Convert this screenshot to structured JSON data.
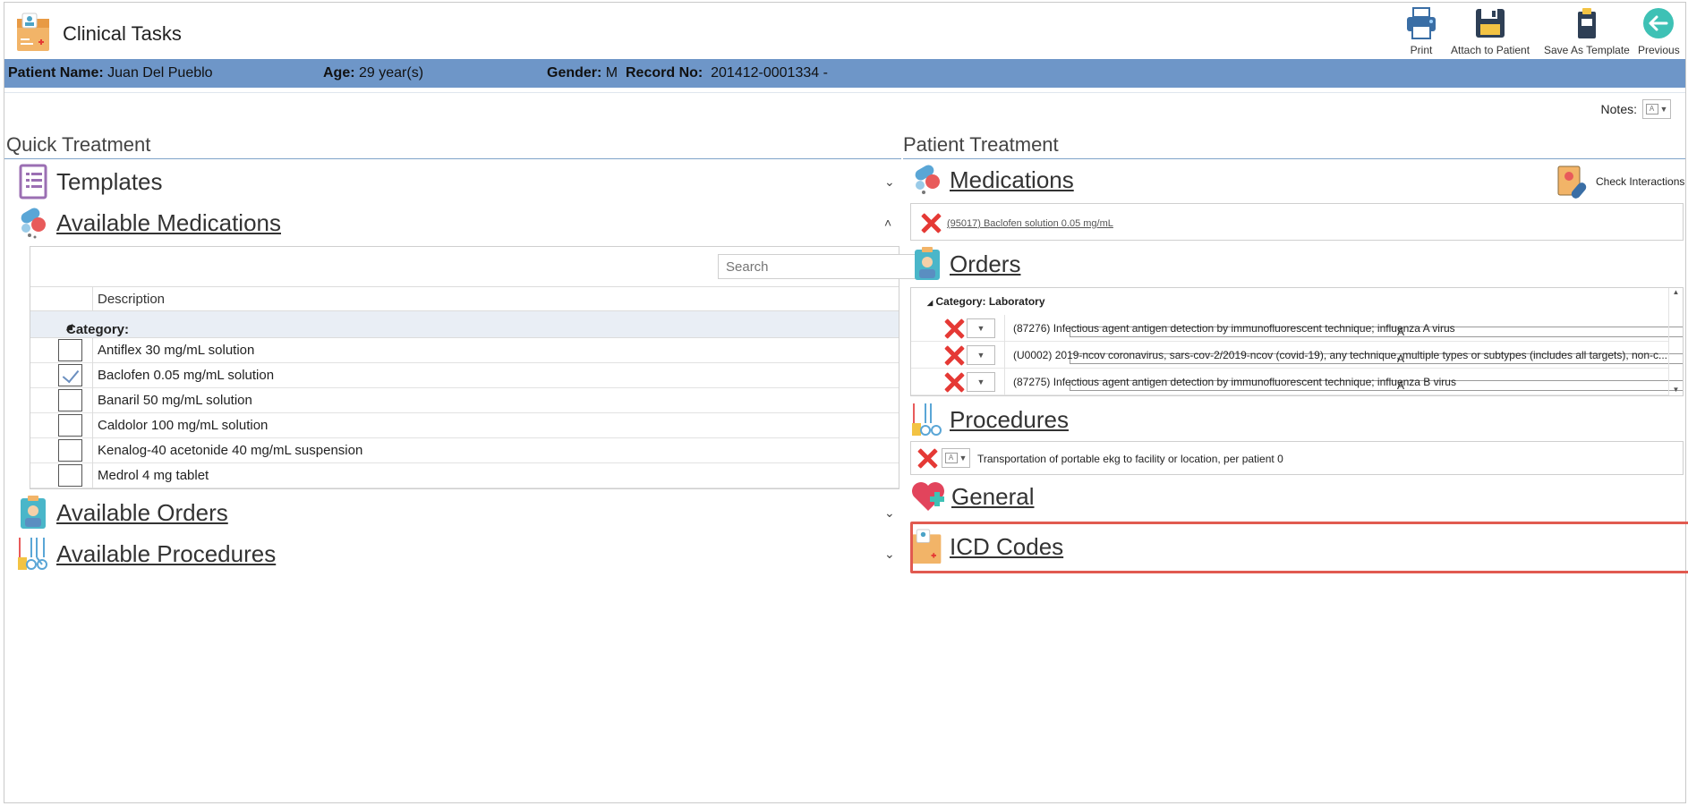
{
  "app": {
    "title": "Clinical Tasks"
  },
  "toolbar": {
    "print": "Print",
    "attach": "Attach to Patient",
    "save_template": "Save As Template",
    "previous": "Previous"
  },
  "patient": {
    "name_label": "Patient Name:",
    "name": "Juan Del Pueblo",
    "age_label": "Age:",
    "age": "29 year(s)",
    "gender_label": "Gender:",
    "gender": "M",
    "record_label": "Record No:",
    "record": "201412-0001334 -"
  },
  "notes": {
    "label": "Notes:"
  },
  "quick_treatment": {
    "title": "Quick Treatment",
    "templates": "Templates",
    "available_medications": "Available Medications",
    "available_orders": "Available Orders",
    "available_procedures": "Available Procedures",
    "search_placeholder": "Search",
    "column_description": "Description",
    "category": "Category:",
    "medications": [
      {
        "name": "Antiflex 30 mg/mL solution",
        "checked": false
      },
      {
        "name": "Baclofen 0.05 mg/mL solution",
        "checked": true
      },
      {
        "name": "Banaril 50 mg/mL solution",
        "checked": false
      },
      {
        "name": "Caldolor 100 mg/mL solution",
        "checked": false
      },
      {
        "name": "Kenalog-40 acetonide 40 mg/mL suspension",
        "checked": false
      },
      {
        "name": "Medrol 4 mg tablet",
        "checked": false
      }
    ]
  },
  "patient_treatment": {
    "title": "Patient Treatment",
    "medications": "Medications",
    "check_interactions": "Check Interactions",
    "med_items": [
      "(95017) Baclofen solution 0.05 mg/mL"
    ],
    "orders": "Orders",
    "orders_category": "Category: Laboratory",
    "order_items": [
      "(87276) Infectious agent antigen detection by immunofluorescent technique; influenza A virus",
      "(U0002) 2019-ncov coronavirus, sars-cov-2/2019-ncov (covid-19), any technique, multiple types or subtypes (includes all targets), non-c...",
      "(87275) Infectious agent antigen detection by immunofluorescent technique; influenza B virus"
    ],
    "procedures": "Procedures",
    "procedure_items": [
      "Transportation of portable ekg to facility or location, per patient 0"
    ],
    "general": "General",
    "icd_codes": "ICD Codes"
  },
  "colors": {
    "header_bar": "#6e96c8",
    "accent": "#7fa3c9",
    "delete": "#e53935",
    "highlight": "#e15a50"
  }
}
